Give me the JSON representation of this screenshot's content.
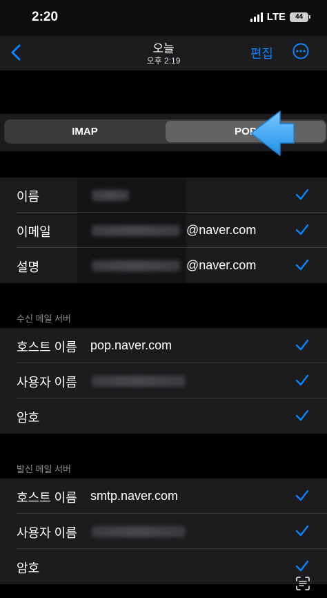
{
  "status": {
    "time": "2:20",
    "network": "LTE",
    "battery": "44"
  },
  "nav": {
    "title": "오늘",
    "subtitle": "오후 2:19",
    "edit_label": "편집"
  },
  "segment": {
    "options": [
      "IMAP",
      "POP"
    ],
    "selected": "POP"
  },
  "account": {
    "rows": [
      {
        "label": "이름",
        "value": ""
      },
      {
        "label": "이메일",
        "value": "@naver.com"
      },
      {
        "label": "설명",
        "value": "@naver.com"
      }
    ]
  },
  "incoming": {
    "header": "수신 메일 서버",
    "rows": [
      {
        "label": "호스트 이름",
        "value": "pop.naver.com"
      },
      {
        "label": "사용자 이름",
        "value": ""
      },
      {
        "label": "암호",
        "value": ""
      }
    ]
  },
  "outgoing": {
    "header": "발신 메일 서버",
    "rows": [
      {
        "label": "호스트 이름",
        "value": "smtp.naver.com"
      },
      {
        "label": "사용자 이름",
        "value": ""
      },
      {
        "label": "암호",
        "value": ""
      }
    ]
  },
  "colors": {
    "accent": "#0a84ff",
    "arrow": "#3aa8f5"
  }
}
